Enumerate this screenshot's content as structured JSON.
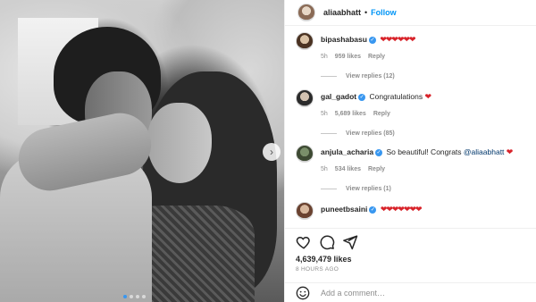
{
  "post": {
    "username": "aliaabhatt",
    "separator": "•",
    "follow_label": "Follow",
    "next_arrow": "›"
  },
  "comments": [
    {
      "user": "bipashabasu",
      "verified": true,
      "text": "",
      "hearts": "❤❤❤❤❤❤",
      "time": "5h",
      "likes": "959 likes",
      "reply_label": "Reply",
      "view_replies": "View replies (12)"
    },
    {
      "user": "gal_gadot",
      "verified": true,
      "text": "Congratulations",
      "hearts": "❤",
      "time": "5h",
      "likes": "5,689 likes",
      "reply_label": "Reply",
      "view_replies": "View replies (85)"
    },
    {
      "user": "anjula_acharia",
      "verified": true,
      "text": "So beautiful! Congrats ",
      "mention": "@aliaabhatt",
      "hearts": "❤",
      "time": "5h",
      "likes": "534 likes",
      "reply_label": "Reply",
      "view_replies": "View replies (1)"
    },
    {
      "user": "puneetbsaini",
      "verified": true,
      "text": "",
      "hearts": "❤❤❤❤❤❤❤"
    }
  ],
  "actions": {
    "likes": "4,639,479 likes",
    "timestamp": "8 HOURS AGO"
  },
  "add_comment": {
    "placeholder": "Add a comment…"
  },
  "colors": {
    "accent": "#0095f6",
    "heart": "#d8232a",
    "muted": "#8e8e8e",
    "verified": "#3897f0"
  },
  "icons": [
    "heart-icon",
    "comment-icon",
    "share-icon",
    "emoji-icon",
    "verified-badge-icon",
    "next-arrow-icon"
  ]
}
